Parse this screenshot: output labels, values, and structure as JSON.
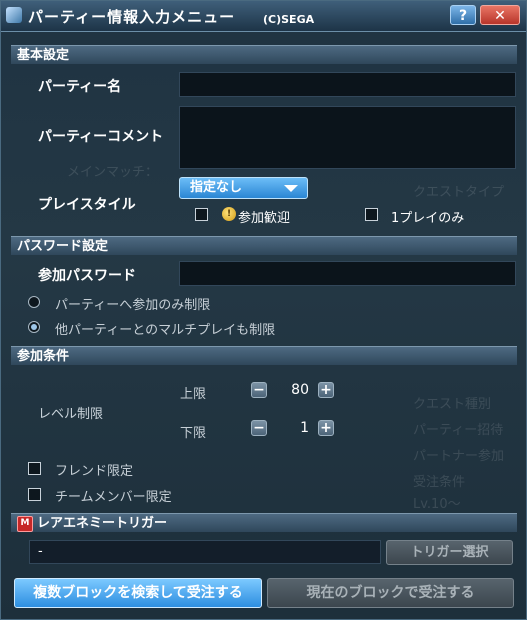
{
  "window": {
    "title": "パーティー情報入力メニュー",
    "copyright": "(C)SEGA",
    "help_label": "?",
    "close_label": "✕"
  },
  "basic": {
    "header": "基本設定",
    "party_name_label": "パーティー名",
    "party_name_value": "",
    "comment_label": "パーティーコメント",
    "comment_value": "",
    "playstyle_label": "プレイスタイル",
    "playstyle_selected": "指定なし",
    "welcome_label": "参加歓迎",
    "solo_label": "1プレイのみ"
  },
  "password": {
    "header": "パスワード設定",
    "label": "参加パスワード",
    "value": "",
    "option1": "パーティーへ参加のみ制限",
    "option2": "他パーティーとのマルチプレイも制限",
    "selected": "option2"
  },
  "conditions": {
    "header": "参加条件",
    "level_label": "レベル制限",
    "upper_label": "上限",
    "upper_value": "80",
    "lower_label": "下限",
    "lower_value": "1",
    "minus": "−",
    "plus": "+",
    "friend_label": "フレンド限定",
    "team_label": "チームメンバー限定"
  },
  "trigger": {
    "header": "レアエネミートリガー",
    "icon_text": "M",
    "value": "-",
    "select_label": "トリガー選択"
  },
  "actions": {
    "search_blocks": "複数ブロックを検索して受注する",
    "current_block": "現在のブロックで受注する"
  },
  "background": {
    "ghost": [
      "メインマッチ：",
      "クエストタイプ",
      "クエスト種別",
      "パーティー招待",
      "パートナー参加",
      "受注条件",
      "Lv.10～"
    ]
  },
  "colors": {
    "accent": "#2d8ee0",
    "section": "#3c566b",
    "window_bg": "#233744"
  }
}
